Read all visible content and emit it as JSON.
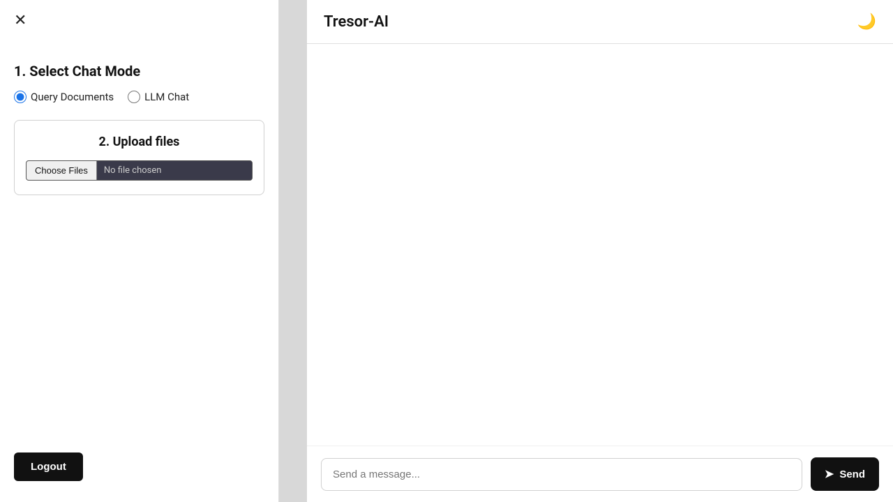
{
  "sidebar": {
    "close_label": "✕",
    "select_mode_title": "1. Select Chat Mode",
    "mode_options": [
      {
        "id": "query-docs",
        "label": "Query Documents",
        "checked": true
      },
      {
        "id": "llm-chat",
        "label": "LLM Chat",
        "checked": false
      }
    ],
    "upload_section_title": "2. Upload files",
    "file_choose_label": "Choose Files",
    "file_no_chosen_label": "No file chosen",
    "logout_label": "Logout"
  },
  "header": {
    "title": "Tresor-AI",
    "dark_mode_icon": "🌙"
  },
  "chat": {
    "input_placeholder": "Send a message...",
    "send_label": "Send",
    "send_icon": "➤"
  }
}
